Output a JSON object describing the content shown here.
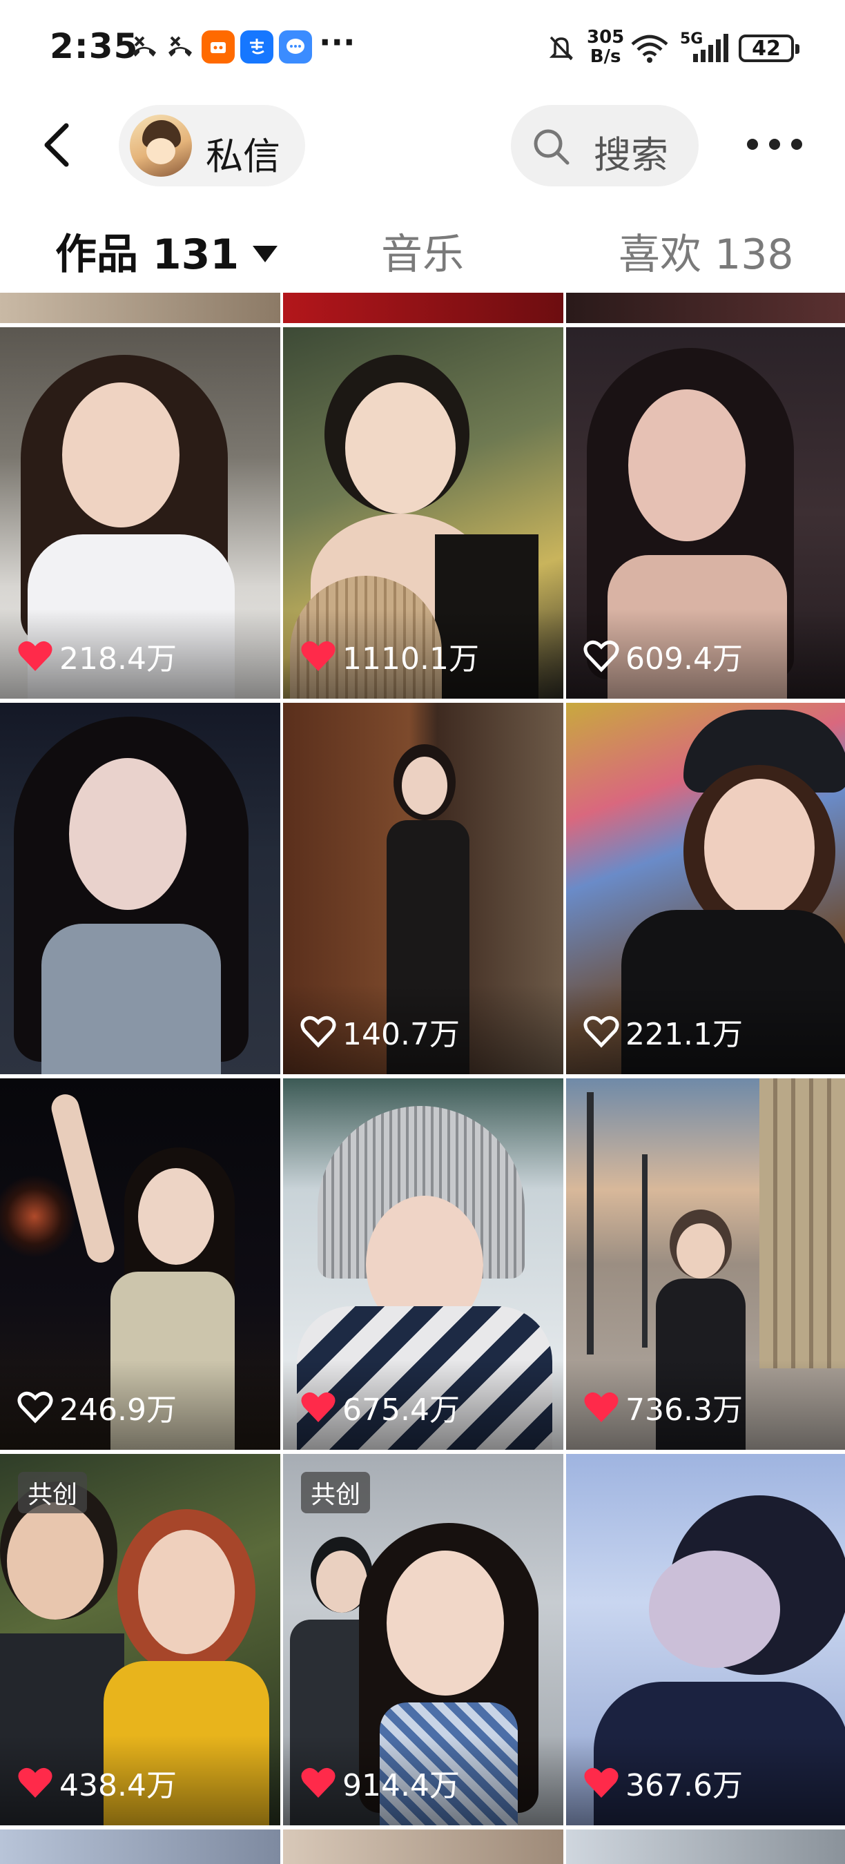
{
  "status_bar": {
    "time": "2:35",
    "net_speed_value": "305",
    "net_speed_unit": "B/s",
    "network": "5G",
    "battery": "42",
    "icons": [
      "missed-call-icon",
      "missed-call-icon",
      "taobao-app-icon",
      "alipay-app-icon",
      "message-app-icon",
      "mute-icon",
      "wifi-icon",
      "signal-icon"
    ]
  },
  "nav": {
    "message_label": "私信",
    "search_label": "搜索"
  },
  "tabs": [
    {
      "label": "作品 131"
    },
    {
      "label": "音乐"
    },
    {
      "label": "喜欢 138"
    }
  ],
  "grid": [
    {
      "likes": "218.4万",
      "liked": true,
      "badge": ""
    },
    {
      "likes": "1110.1万",
      "liked": true,
      "badge": ""
    },
    {
      "likes": "609.4万",
      "liked": false,
      "badge": ""
    },
    {
      "likes": "",
      "liked": false,
      "badge": ""
    },
    {
      "likes": "140.7万",
      "liked": false,
      "badge": ""
    },
    {
      "likes": "221.1万",
      "liked": false,
      "badge": ""
    },
    {
      "likes": "246.9万",
      "liked": false,
      "badge": ""
    },
    {
      "likes": "675.4万",
      "liked": true,
      "badge": ""
    },
    {
      "likes": "736.3万",
      "liked": true,
      "badge": ""
    },
    {
      "likes": "438.4万",
      "liked": true,
      "badge": "共创"
    },
    {
      "likes": "914.4万",
      "liked": true,
      "badge": "共创"
    },
    {
      "likes": "367.6万",
      "liked": true,
      "badge": ""
    }
  ],
  "colors": {
    "liked_heart": "#ff2a4a",
    "tab_active": "#111111",
    "tab_inactive": "#7a7a7a"
  }
}
